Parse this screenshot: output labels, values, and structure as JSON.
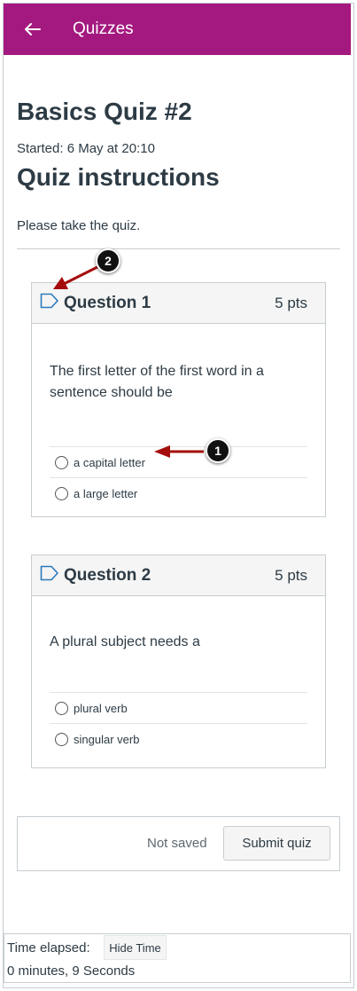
{
  "header": {
    "back_icon": "arrow-left-icon",
    "title": "Quizzes",
    "color": "#a4197f"
  },
  "quiz": {
    "title": "Basics Quiz #2",
    "started": "Started: 6 May at 20:10",
    "instructions_heading": "Quiz instructions",
    "instructions_body": "Please take the quiz."
  },
  "questions": [
    {
      "flag_icon": "bookmark-flag-icon",
      "name": "Question 1",
      "points": "5 pts",
      "text": "The first letter of the first word in a sentence should be",
      "answers": [
        "a capital letter",
        "a large letter"
      ]
    },
    {
      "flag_icon": "bookmark-flag-icon",
      "name": "Question 2",
      "points": "5 pts",
      "text": "A plural subject needs a",
      "answers": [
        "plural verb",
        "singular verb"
      ]
    }
  ],
  "footer": {
    "status": "Not saved",
    "submit_label": "Submit quiz"
  },
  "timer": {
    "label": "Time elapsed:",
    "hide_label": "Hide Time",
    "value": "0 minutes, 9 Seconds"
  },
  "callouts": [
    "1",
    "2"
  ],
  "annotation_color": "#a50d0d"
}
